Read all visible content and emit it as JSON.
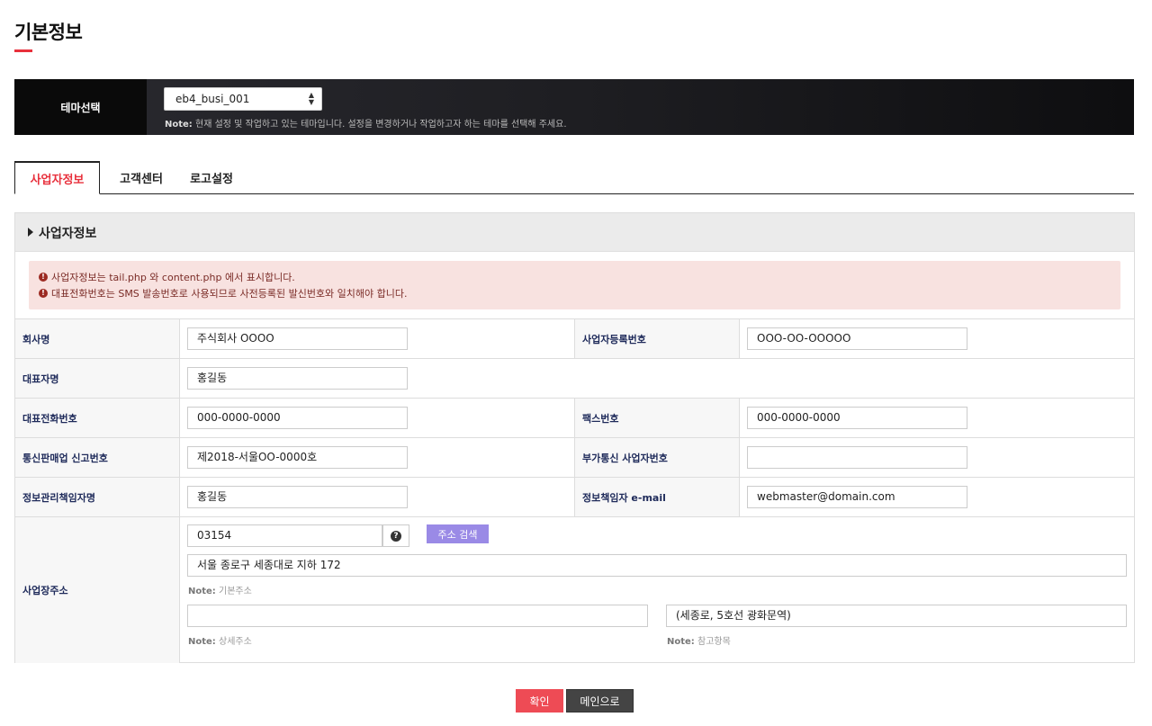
{
  "page": {
    "title": "기본정보"
  },
  "theme": {
    "label": "테마선택",
    "selected": "eb4_busi_001",
    "note_prefix": "Note:",
    "note_text": "현재 설정 및 작업하고 있는 테마입니다. 설정을 변경하거나 작업하고자 하는 테마를 선택해 주세요."
  },
  "tabs": [
    {
      "label": "사업자정보",
      "active": true
    },
    {
      "label": "고객센터",
      "active": false
    },
    {
      "label": "로고설정",
      "active": false
    }
  ],
  "panel": {
    "title": "사업자정보",
    "alerts": [
      "사업자정보는 tail.php 와 content.php 에서 표시합니다.",
      "대표전화번호는 SMS 발송번호로 사용되므로 사전등록된 발신번호와 일치해야 합니다."
    ]
  },
  "form": {
    "company_name": {
      "label": "회사명",
      "value": "주식회사 OOOO"
    },
    "biz_reg_no": {
      "label": "사업자등록번호",
      "value": "OOO-OO-OOOOO"
    },
    "ceo_name": {
      "label": "대표자명",
      "value": "홍길동"
    },
    "phone": {
      "label": "대표전화번호",
      "value": "000-0000-0000"
    },
    "fax": {
      "label": "팩스번호",
      "value": "000-0000-0000"
    },
    "ecommerce_no": {
      "label": "통신판매업 신고번호",
      "value": "제2018-서울OO-0000호"
    },
    "vas_no": {
      "label": "부가통신 사업자번호",
      "value": ""
    },
    "privacy_officer": {
      "label": "정보관리책임자명",
      "value": "홍길동"
    },
    "privacy_email": {
      "label": "정보책임자 e-mail",
      "value": "webmaster@domain.com"
    },
    "address": {
      "label": "사업장주소",
      "zipcode": "03154",
      "search_button": "주소 검색",
      "base": "서울 종로구 세종대로 지하 172",
      "base_note": "기본주소",
      "detail": "",
      "detail_note": "상세주소",
      "extra": "(세종로, 5호선 광화문역)",
      "extra_note": "참고항목",
      "note_prefix": "Note:"
    }
  },
  "buttons": {
    "confirm": "확인",
    "main": "메인으로"
  },
  "colors": {
    "accent": "#e8303c",
    "label_text": "#1e2a5a",
    "search_button": "#9a8ae6",
    "alert_bg": "#f8e2e0"
  }
}
